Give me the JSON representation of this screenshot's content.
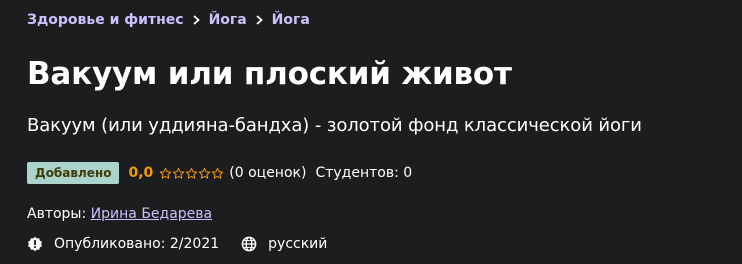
{
  "breadcrumb": {
    "items": [
      "Здоровье и фитнес",
      "Йога",
      "Йога"
    ]
  },
  "course": {
    "title": "Вакуум или плоский живот",
    "subtitle": "Вакуум (или уддияна-бандха) - золотой фонд классической йоги"
  },
  "rating": {
    "badge": "Добавлено",
    "value": "0,0",
    "stars_filled": 0,
    "stars_total": 5,
    "count_text": "(0 оценок)",
    "students_text": "Студентов: 0"
  },
  "authors": {
    "label": "Авторы:",
    "name": "Ирина Бедарева"
  },
  "meta": {
    "published": "Опубликовано: 2/2021",
    "language": "русский",
    "published_icon": "alert-badge-icon",
    "language_icon": "globe-icon"
  },
  "colors": {
    "background": "#1c1d1f",
    "link": "#cec0fc",
    "rating": "#f69c08",
    "badge_bg": "#acd2cc",
    "badge_text": "#3d3c0a"
  }
}
